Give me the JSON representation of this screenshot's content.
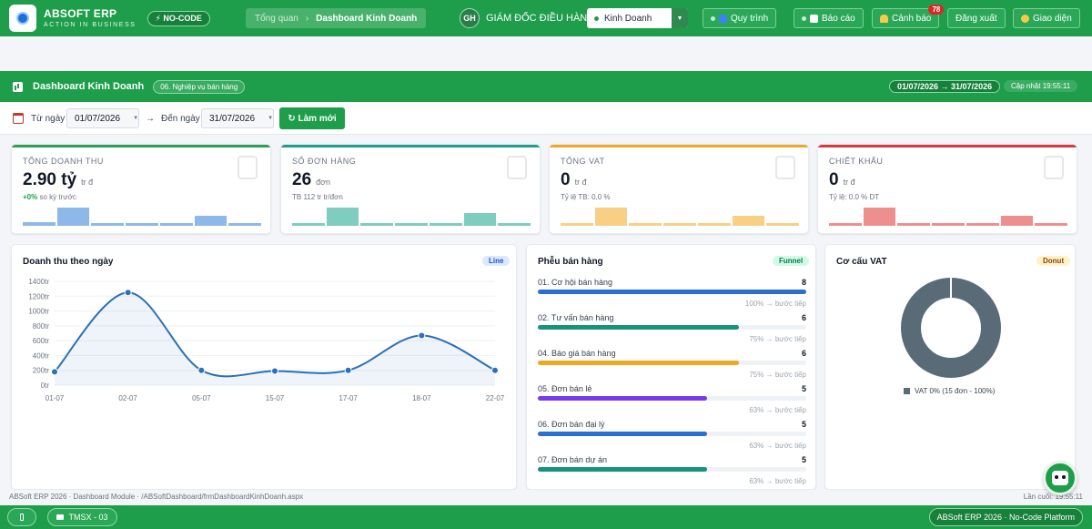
{
  "topbar": {
    "brand_name": "ABSOFT ERP",
    "brand_tagline": "ACTION IN BUSINESS",
    "nocode_badge": "⚡ NO-CODE",
    "breadcrumb_home": "Tổng quan",
    "breadcrumb_sep": "›",
    "breadcrumb_current": "Dashboard Kinh Doanh",
    "avatar_initials": "GH",
    "role": "GIÁM ĐỐC ĐIỀU HÀNH",
    "department": "Kinh Doanh",
    "buttons": {
      "process": "Quy trình",
      "reports": "Báo cáo",
      "alerts": "Cảnh báo",
      "alerts_count": "78",
      "logout": "Đăng xuất",
      "theme": "Giao diện"
    }
  },
  "module": {
    "title": "Dashboard Kinh Doanh",
    "tag": "06. Nghiệp vụ bán hàng",
    "range": "01/07/2026 → 31/07/2026",
    "updated": "Cập nhật 19:55:11"
  },
  "filter": {
    "from_label": "Từ ngày",
    "from_value": "01/07/2026",
    "arrow": "→",
    "to_label": "Đến ngày",
    "to_value": "31/07/2026",
    "refresh_label": "↻ Làm mới"
  },
  "kpis": [
    {
      "label": "TỔNG DOANH THU",
      "value": "2.90 tỷ",
      "unit": "tr đ",
      "sub_prefix": "+0%",
      "sub_text": " so kỳ trước",
      "color": "#2f9e55",
      "bar_color": "#8db8ea",
      "bars": [
        0.18,
        0.85,
        0.12,
        0.12,
        0.12,
        0.45,
        0.12
      ]
    },
    {
      "label": "SỐ ĐƠN HÀNG",
      "value": "26",
      "unit": "đơn",
      "sub_prefix": "",
      "sub_text": "TB 112 tr tr/đơn",
      "color": "#1f9e8e",
      "bar_color": "#7fcdbf",
      "bars": [
        0.12,
        0.85,
        0.12,
        0.12,
        0.12,
        0.6,
        0.12
      ]
    },
    {
      "label": "TỔNG VAT",
      "value": "0",
      "unit": "tr đ",
      "sub_prefix": "",
      "sub_text": "Tỷ lệ TB: 0.0 %",
      "color": "#f0a722",
      "bar_color": "#f8cf85",
      "bars": [
        0.12,
        0.85,
        0.12,
        0.12,
        0.12,
        0.45,
        0.12
      ]
    },
    {
      "label": "CHIẾT KHẤU",
      "value": "0",
      "unit": "tr đ",
      "sub_prefix": "",
      "sub_text": "Tỷ lệ: 0.0 % DT",
      "color": "#d63b3b",
      "bar_color": "#ee8f8f",
      "bars": [
        0.12,
        0.85,
        0.12,
        0.12,
        0.12,
        0.45,
        0.12
      ]
    }
  ],
  "revenue_panel": {
    "title": "Doanh thu theo ngày",
    "pill": "Line"
  },
  "funnel_panel": {
    "title": "Phễu bán hàng",
    "pill": "Funnel",
    "rows": [
      {
        "name": "01. Cơ hội bán hàng",
        "count": "8",
        "fill": 1.0,
        "color": "#2b6fd1",
        "pct": "100% → bước tiếp"
      },
      {
        "name": "02. Tư vấn bán hàng",
        "count": "6",
        "fill": 0.75,
        "color": "#17927f",
        "pct": "75% → bước tiếp"
      },
      {
        "name": "04. Báo giá bán hàng",
        "count": "6",
        "fill": 0.75,
        "color": "#f0a722",
        "pct": "75% → bước tiếp"
      },
      {
        "name": "05. Đơn bán lẻ",
        "count": "5",
        "fill": 0.63,
        "color": "#7c3aed",
        "pct": "63% → bước tiếp"
      },
      {
        "name": "06. Đơn bán đại lý",
        "count": "5",
        "fill": 0.63,
        "color": "#2b6fd1",
        "pct": "63% → bước tiếp"
      },
      {
        "name": "07. Đơn bán dự án",
        "count": "5",
        "fill": 0.63,
        "color": "#17927f",
        "pct": "63% → bước tiếp"
      }
    ]
  },
  "vat_panel": {
    "title": "Cơ cấu VAT",
    "pill": "Donut",
    "legend": "VAT 0%  (15 đơn - 100%)"
  },
  "chart_data": [
    {
      "type": "line",
      "x": [
        "01-07",
        "02-07",
        "05-07",
        "15-07",
        "17-07",
        "18-07",
        "22-07"
      ],
      "series": [
        {
          "values": [
            180,
            1250,
            200,
            190,
            200,
            670,
            200
          ],
          "color": "#2b6fb8"
        }
      ],
      "yticks": [
        "0tr",
        "200tr",
        "400tr",
        "600tr",
        "800tr",
        "1000tr",
        "1200tr",
        "1400tr"
      ],
      "ylim": [
        0,
        1400
      ],
      "grid": true
    },
    {
      "type": "pie",
      "categories": [
        "VAT 0%"
      ],
      "values": [
        100
      ],
      "colors": [
        "#5a6b78"
      ]
    }
  ],
  "footer": {
    "left": "ABSoft ERP 2026 · Dashboard Module · /ABSoftDashboard/frmDashboardKinhDoanh.aspx",
    "right": "Lần cuối: 19:55:11",
    "tab_label": "TMSX - 03",
    "platform": "ABSoft ERP 2026  ·  No-Code Platform"
  }
}
